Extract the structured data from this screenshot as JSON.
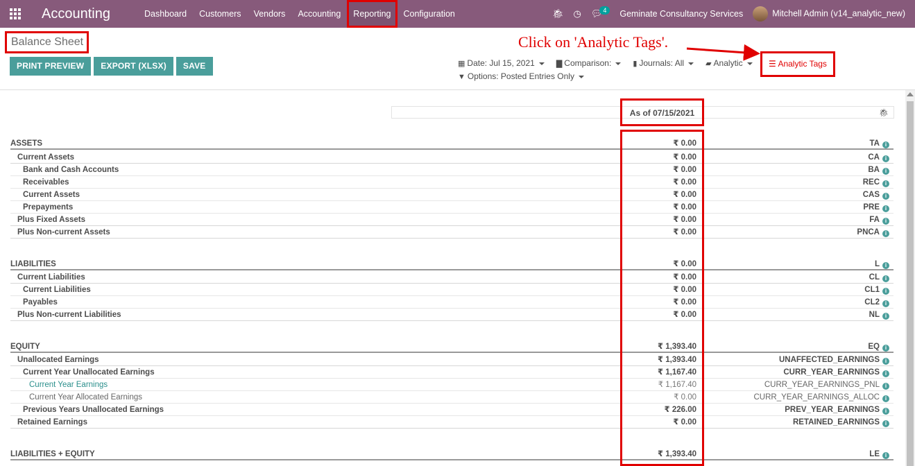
{
  "navbar": {
    "app_name": "Accounting",
    "menu": [
      "Dashboard",
      "Customers",
      "Vendors",
      "Accounting",
      "Reporting",
      "Configuration"
    ],
    "messages_count": "4",
    "company": "Geminate Consultancy Services",
    "user": "Mitchell Admin (v14_analytic_new)"
  },
  "page": {
    "title": "Balance Sheet",
    "buttons": {
      "print": "PRINT PREVIEW",
      "export": "EXPORT (XLSX)",
      "save": "SAVE"
    },
    "annotation": "Click on 'Analytic Tags'.",
    "filters": {
      "date": "Date: Jul 15, 2021",
      "comparison": "Comparison:",
      "journals": "Journals: All",
      "analytic": "Analytic",
      "analytic_tags": "Analytic Tags",
      "options": "Options: Posted Entries Only"
    }
  },
  "report": {
    "column_header": "As of 07/15/2021",
    "rows": [
      {
        "label": "ASSETS",
        "value": "₹ 0.00",
        "code": "TA"
      },
      {
        "label": "Current Assets",
        "value": "₹ 0.00",
        "code": "CA"
      },
      {
        "label": "Bank and Cash Accounts",
        "value": "₹ 0.00",
        "code": "BA"
      },
      {
        "label": "Receivables",
        "value": "₹ 0.00",
        "code": "REC"
      },
      {
        "label": "Current Assets",
        "value": "₹ 0.00",
        "code": "CAS"
      },
      {
        "label": "Prepayments",
        "value": "₹ 0.00",
        "code": "PRE"
      },
      {
        "label": "Plus Fixed Assets",
        "value": "₹ 0.00",
        "code": "FA"
      },
      {
        "label": "Plus Non-current Assets",
        "value": "₹ 0.00",
        "code": "PNCA"
      },
      {
        "label": "LIABILITIES",
        "value": "₹ 0.00",
        "code": "L"
      },
      {
        "label": "Current Liabilities",
        "value": "₹ 0.00",
        "code": "CL"
      },
      {
        "label": "Current Liabilities",
        "value": "₹ 0.00",
        "code": "CL1"
      },
      {
        "label": "Payables",
        "value": "₹ 0.00",
        "code": "CL2"
      },
      {
        "label": "Plus Non-current Liabilities",
        "value": "₹ 0.00",
        "code": "NL"
      },
      {
        "label": "EQUITY",
        "value": "₹ 1,393.40",
        "code": "EQ"
      },
      {
        "label": "Unallocated Earnings",
        "value": "₹ 1,393.40",
        "code": "UNAFFECTED_EARNINGS"
      },
      {
        "label": "Current Year Unallocated Earnings",
        "value": "₹ 1,167.40",
        "code": "CURR_YEAR_EARNINGS"
      },
      {
        "label": "Current Year Earnings",
        "value": "₹ 1,167.40",
        "code": "CURR_YEAR_EARNINGS_PNL"
      },
      {
        "label": "Current Year Allocated Earnings",
        "value": "₹ 0.00",
        "code": "CURR_YEAR_EARNINGS_ALLOC"
      },
      {
        "label": "Previous Years Unallocated Earnings",
        "value": "₹ 226.00",
        "code": "PREV_YEAR_EARNINGS"
      },
      {
        "label": "Retained Earnings",
        "value": "₹ 0.00",
        "code": "RETAINED_EARNINGS"
      },
      {
        "label": "LIABILITIES + EQUITY",
        "value": "₹ 1,393.40",
        "code": "LE"
      }
    ]
  }
}
